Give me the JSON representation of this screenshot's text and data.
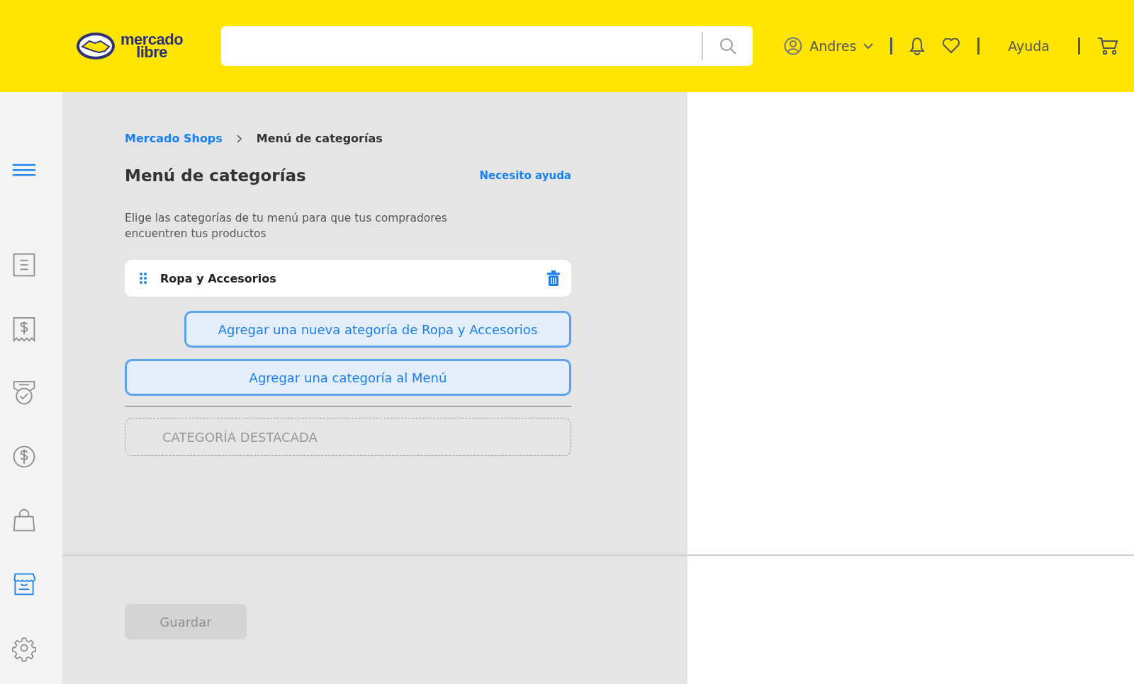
{
  "header": {
    "logo": {
      "line1": "mercado",
      "line2": "libre"
    },
    "user": {
      "name": "Andres"
    },
    "help": "Ayuda"
  },
  "sidebar": {
    "items": [
      {
        "kind": "list",
        "selected": false
      },
      {
        "kind": "receipt",
        "selected": false
      },
      {
        "kind": "medal",
        "selected": false
      },
      {
        "kind": "money",
        "selected": false
      },
      {
        "kind": "bag",
        "selected": false
      },
      {
        "kind": "store",
        "selected": true
      },
      {
        "kind": "gear",
        "selected": false
      }
    ]
  },
  "breadcrumb": [
    {
      "label": "Mercado Shops",
      "link": true
    },
    {
      "label": "Menú de categorías",
      "link": false
    }
  ],
  "page": {
    "title": "Menú de categorías",
    "help_link": "Necesito ayuda",
    "description": "Elige las categorías de tu menú para que tus compradores encuentren tus productos"
  },
  "categories": [
    {
      "name": "Ropa y Accesorios"
    }
  ],
  "add_subcategory_button": "Agregar una nueva ategoría de Ropa y Accesorios",
  "add_category_button": "Agregar una categoría al Menú",
  "featured_placeholder": "CATEGORÍA DESTACADA",
  "save_button": {
    "label": "Guardar",
    "disabled": true
  }
}
